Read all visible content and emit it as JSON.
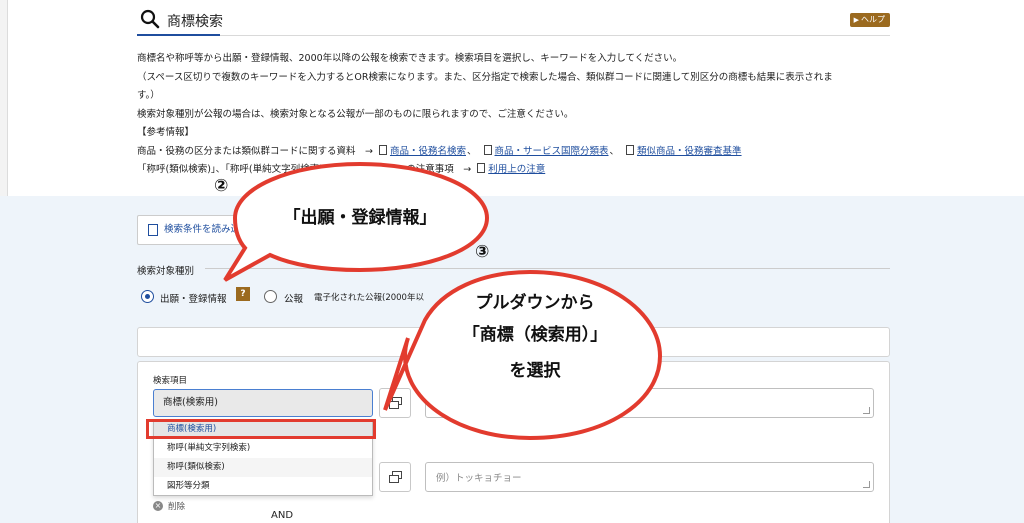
{
  "header": {
    "title": "商標検索",
    "help_label": "ヘルプ"
  },
  "description": {
    "line1": "商標名や称呼等から出願・登録情報、2000年以降の公報を検索できます。検索項目を選択し、キーワードを入力してください。",
    "line2": "（スペース区切りで複数のキーワードを入力するとOR検索になります。また、区分指定で検索した場合、類似群コードに関連して別区分の商標も結果に表示されま",
    "line3": "す。）",
    "line4": "検索対象種別が公報の場合は、検索対象となる公報が一部のものに限られますので、ご注意ください。",
    "ref_heading": "【参考情報】",
    "ref1_text": "商品・役務の区分または類似群コードに関する資料　→",
    "ref1_links": [
      "商品・役務名検索",
      "商品・サービス国際分類表",
      "類似商品・役務審査基準"
    ],
    "ref2_text": "「称呼(類似検索)」、「称呼(単純文字列検索)」、「商標(検索用)」の注意事項　→",
    "ref2_link": "利用上の注意",
    "link_sep": "、"
  },
  "load_button": {
    "label": "検索条件を読み込"
  },
  "search_target": {
    "label": "検索対象種別",
    "option1": "出願・登録情報",
    "option2": "公報",
    "help_q": "?",
    "note": "電子化された公報(2000年以"
  },
  "search_items": {
    "label": "検索項目",
    "selected": "商標(検索用)",
    "options": [
      "商標(検索用)",
      "称呼(単純文字列検索)",
      "称呼(類似検索)",
      "図形等分類"
    ],
    "kw1_placeholder": "例）特許庁　内閣　首相",
    "kw2_placeholder": "例）トッキョチョー",
    "delete_label": "削除",
    "and_label": "AND"
  },
  "annotations": {
    "num2": "②",
    "num3": "③",
    "bubble1": "「出願・登録情報」",
    "bubble2_line1": "プルダウンから",
    "bubble2_line2": "「商標（検索用）」",
    "bubble2_line3": "を選択",
    "color": "#e23b2e"
  }
}
